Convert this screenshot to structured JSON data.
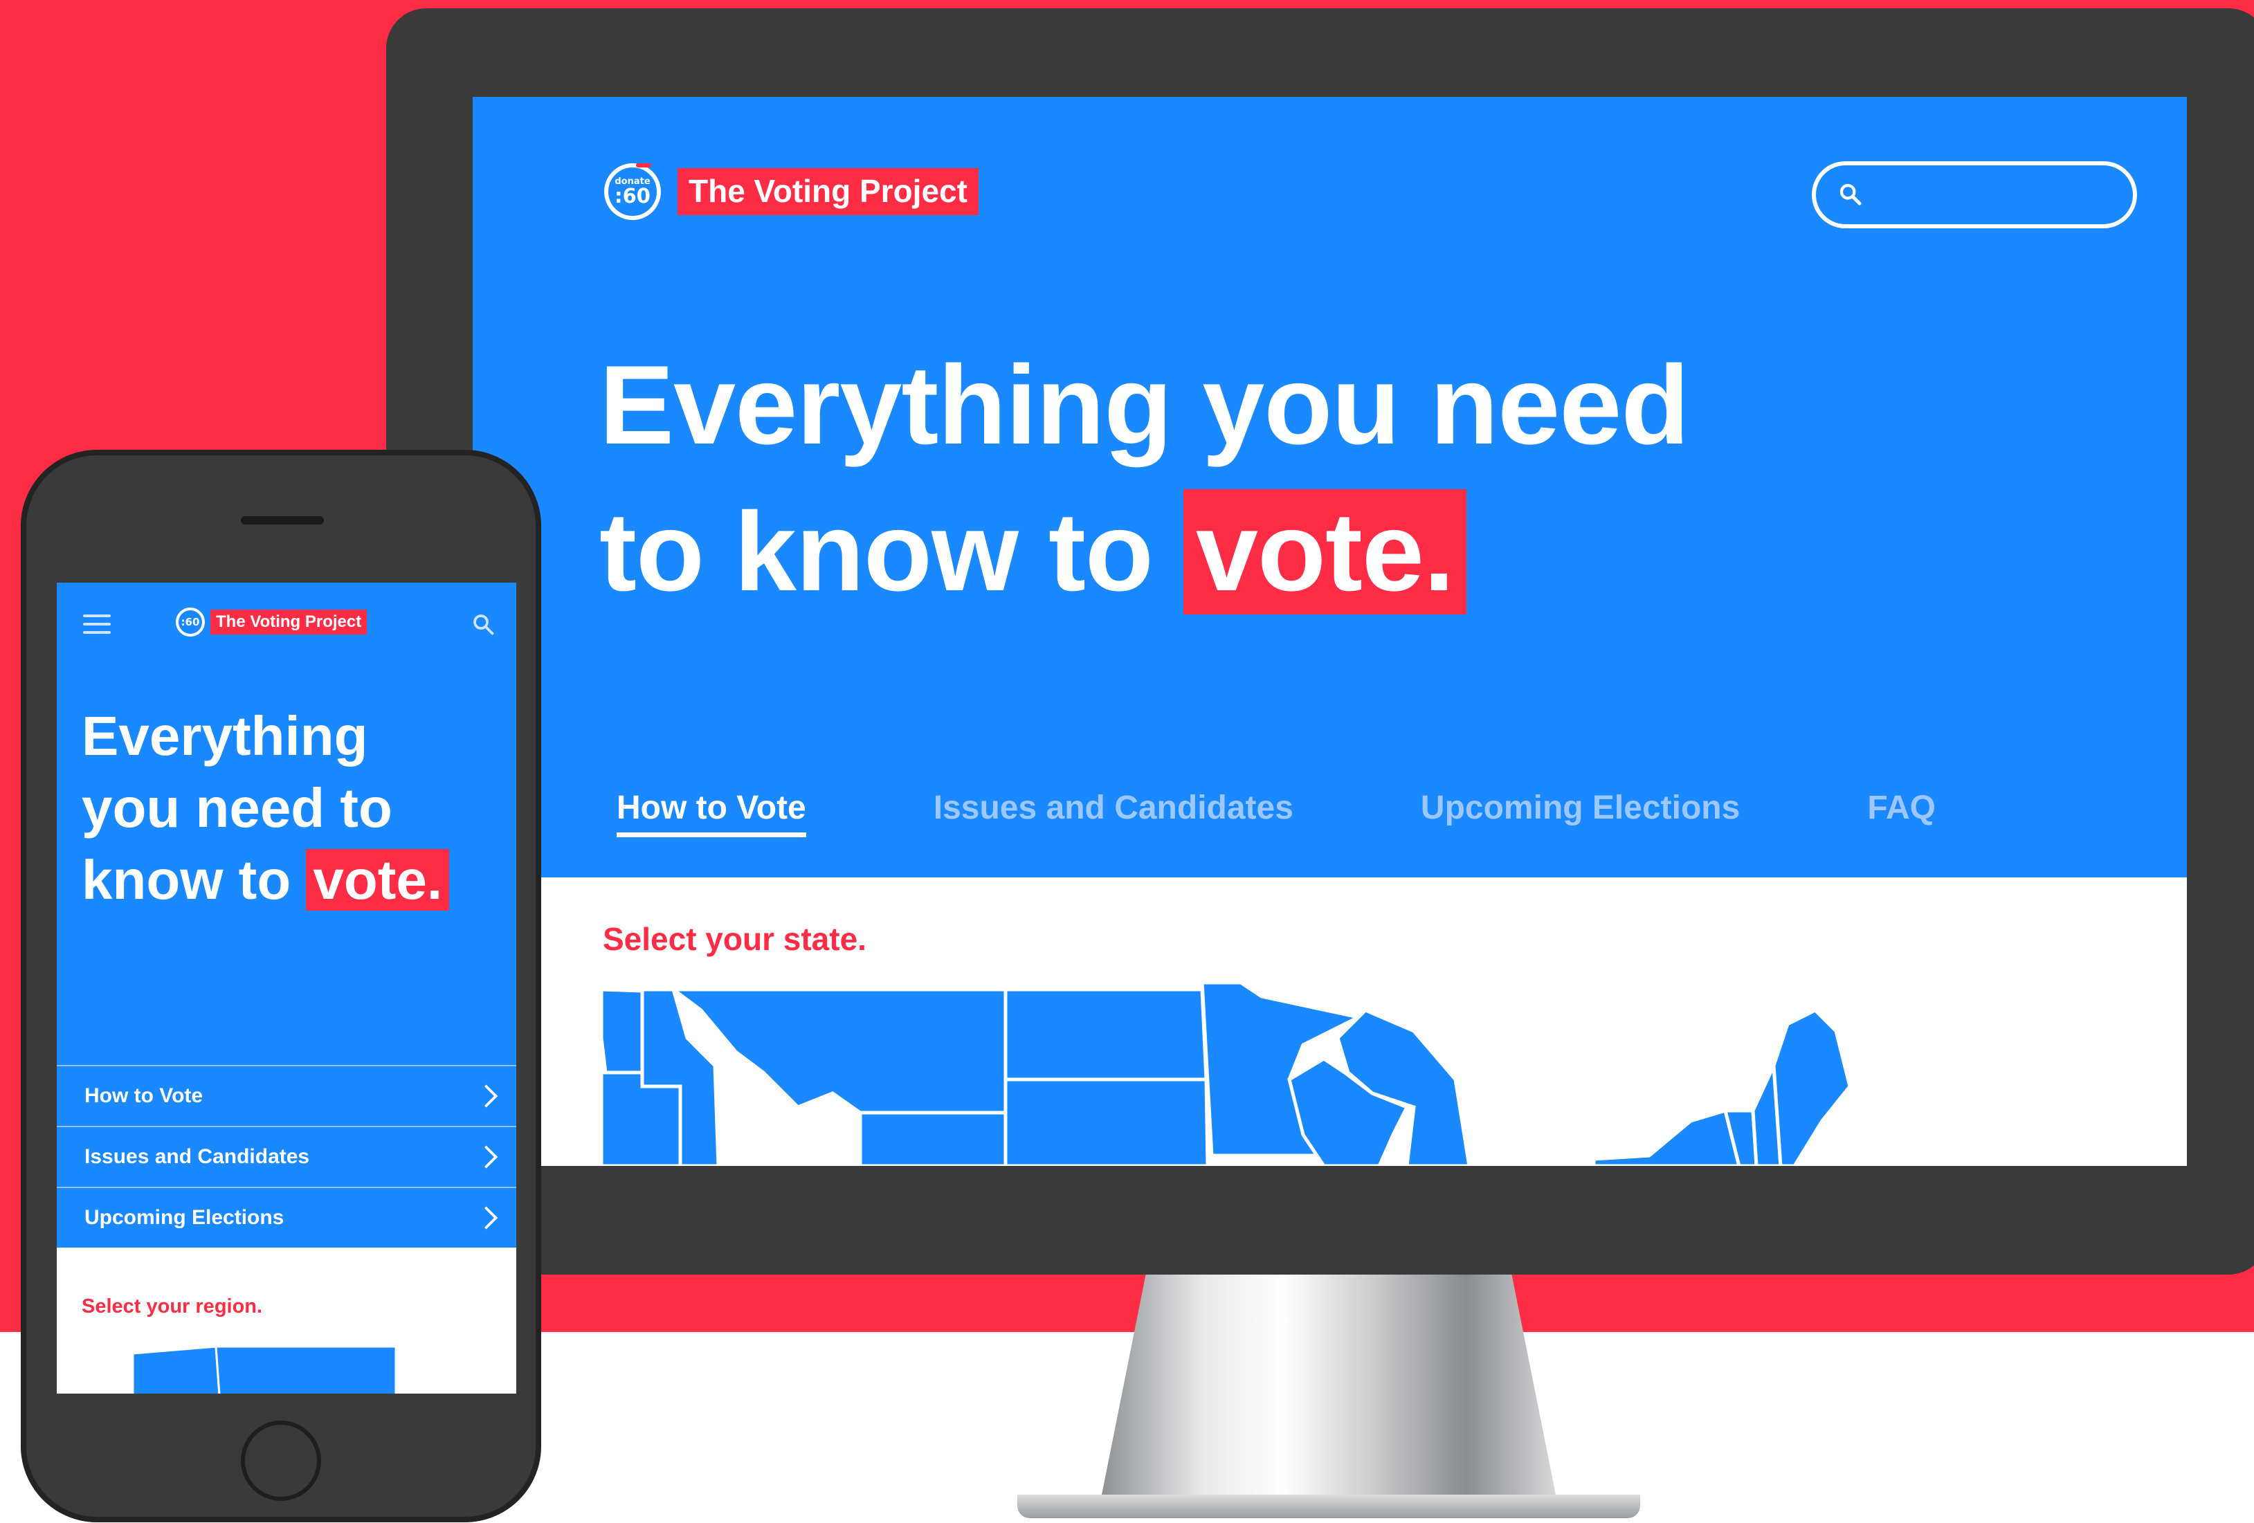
{
  "colors": {
    "brand_blue": "#1a88ff",
    "brand_red": "#ff2c45",
    "tab_inactive": "#9dc8ff"
  },
  "desktop": {
    "logo": {
      "small": "donate",
      "large": ":60",
      "brand": "The Voting Project"
    },
    "search": {
      "placeholder": ""
    },
    "headline": {
      "line1": "Everything you need",
      "line2_prefix": "to know to",
      "highlight": "vote."
    },
    "tabs": [
      {
        "label": "How to Vote",
        "active": true
      },
      {
        "label": "Issues and Candidates",
        "active": false
      },
      {
        "label": "Upcoming Elections",
        "active": false
      },
      {
        "label": "FAQ",
        "active": false
      }
    ],
    "select_prompt": "Select your state."
  },
  "mobile": {
    "logo": {
      "large": ":60",
      "brand": "The Voting Project"
    },
    "headline": {
      "line1": "Everything",
      "line2": "you need to",
      "line3_prefix": "know to",
      "highlight": "vote."
    },
    "nav_items": [
      {
        "label": "How to Vote"
      },
      {
        "label": "Issues and Candidates"
      },
      {
        "label": "Upcoming Elections"
      }
    ],
    "select_prompt": "Select your region."
  },
  "icons": [
    "search-icon",
    "menu-icon",
    "chevron-right-icon",
    "logo-icon"
  ]
}
